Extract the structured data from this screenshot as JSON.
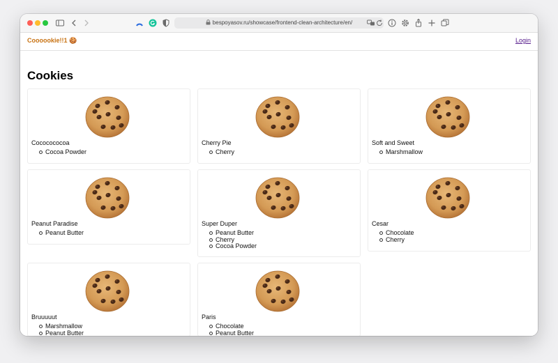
{
  "browser": {
    "url": "bespoyasov.ru/showcase/frontend-clean-architecture/en/"
  },
  "header": {
    "brand": "Coooookie!!1 🍪",
    "login": "Login"
  },
  "page_title": "Cookies",
  "cookies": [
    {
      "name": "Cococococoa",
      "ingredients": [
        "Cocoa Powder"
      ]
    },
    {
      "name": "Cherry Pie",
      "ingredients": [
        "Cherry"
      ]
    },
    {
      "name": "Soft and Sweet",
      "ingredients": [
        "Marshmallow"
      ]
    },
    {
      "name": "Peanut Paradise",
      "ingredients": [
        "Peanut Butter"
      ]
    },
    {
      "name": "Super Duper",
      "ingredients": [
        "Peanut Butter",
        "Cherry",
        "Cocoa Powder"
      ]
    },
    {
      "name": "Cesar",
      "ingredients": [
        "Chocolate",
        "Cherry"
      ]
    },
    {
      "name": "Bruuuuut",
      "ingredients": [
        "Marshmallow",
        "Peanut Butter"
      ]
    },
    {
      "name": "Paris",
      "ingredients": [
        "Chocolate",
        "Peanut Butter"
      ]
    }
  ],
  "colors": {
    "brand": "#c87212",
    "link": "#551a8b"
  }
}
